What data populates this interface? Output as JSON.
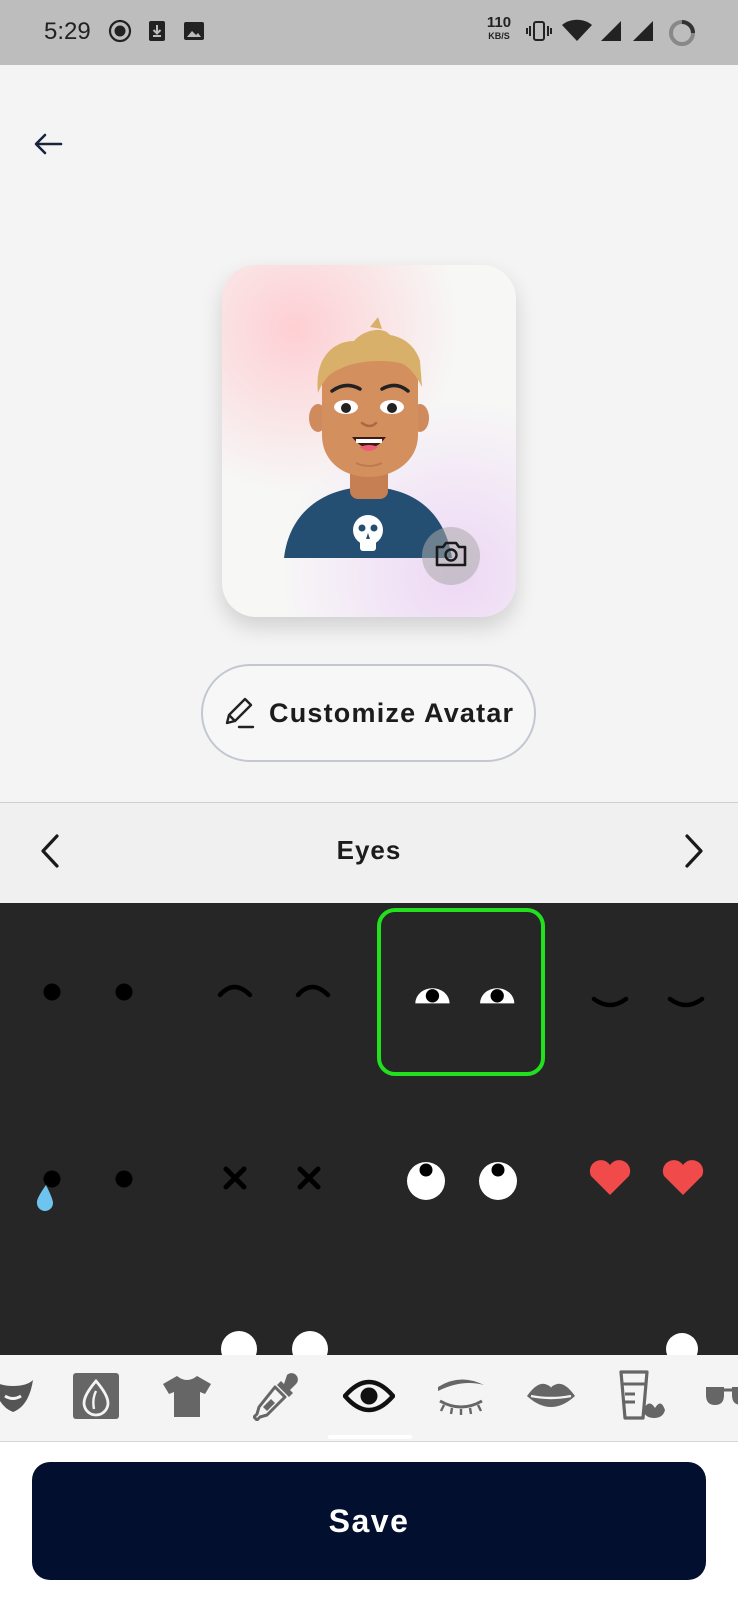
{
  "status_bar": {
    "time": "5:29",
    "net_speed_value": "110",
    "net_speed_unit": "KB/S",
    "icons": [
      "record-icon",
      "download-icon",
      "image-icon",
      "vibrate-icon",
      "wifi-icon",
      "signal-icon",
      "signal-icon",
      "battery-ring-icon"
    ]
  },
  "header": {
    "back_icon": "arrow-left-icon"
  },
  "avatar": {
    "camera_icon": "camera-icon"
  },
  "customize": {
    "label": "Customize Avatar",
    "icon": "pencil-icon"
  },
  "category": {
    "title": "Eyes",
    "prev_icon": "chevron-left-icon",
    "next_icon": "chevron-right-icon"
  },
  "eye_options": {
    "selected_index": 2,
    "items": [
      "dots",
      "arches",
      "round-open",
      "closed-smile",
      "tear-dots",
      "crosses",
      "look-up",
      "hearts"
    ],
    "accent": "#22e01e",
    "heart_color": "#f04a4a",
    "tear_color": "#6ec4ee"
  },
  "tabs": {
    "active_index": 4,
    "items": [
      "beard-icon",
      "skin-tone-icon",
      "shirt-icon",
      "dropper-icon",
      "eye-icon",
      "eyebrow-icon",
      "lips-icon",
      "cup-icon",
      "glasses-icon"
    ]
  },
  "save": {
    "label": "Save",
    "color": "#020f2e"
  }
}
